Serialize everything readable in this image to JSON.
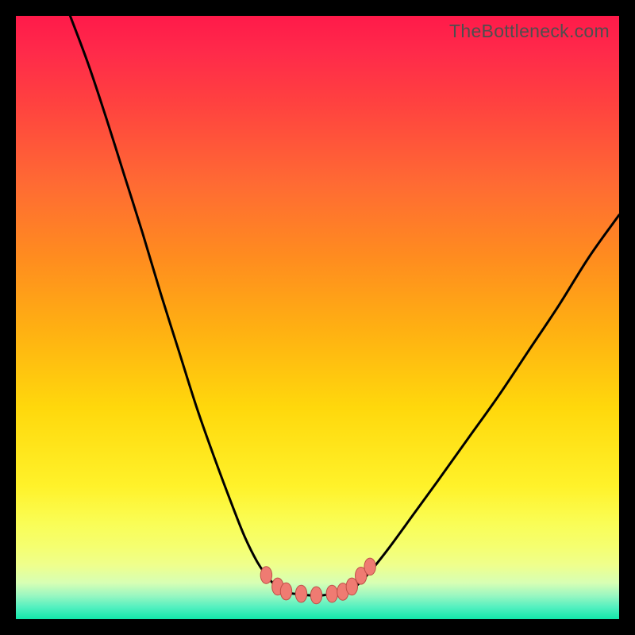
{
  "watermark": "TheBottleneck.com",
  "chart_data": {
    "type": "line",
    "title": "",
    "xlabel": "",
    "ylabel": "",
    "xlim": [
      0,
      100
    ],
    "ylim": [
      0,
      100
    ],
    "series": [
      {
        "name": "left-curve",
        "x": [
          9,
          12,
          15,
          18,
          21,
          24,
          27,
          30,
          33,
          36,
          38,
          40,
          41.5,
          43,
          44
        ],
        "values": [
          100,
          92,
          83,
          73.5,
          64,
          54,
          44.5,
          35,
          26.5,
          18.5,
          13.5,
          9.5,
          7.3,
          5.5,
          4.5
        ]
      },
      {
        "name": "right-curve",
        "x": [
          55,
          57,
          59,
          62,
          66,
          70,
          75,
          80,
          85,
          90,
          95,
          100
        ],
        "values": [
          4.5,
          6,
          8.2,
          12,
          17.5,
          23,
          30,
          37,
          44.5,
          52,
          60,
          67
        ]
      },
      {
        "name": "flat-bottom",
        "x": [
          44,
          47,
          50,
          52,
          55
        ],
        "values": [
          4.5,
          4.1,
          3.9,
          4.1,
          4.5
        ]
      }
    ],
    "annotations": [
      {
        "name": "bottom-markers",
        "type": "scatter",
        "x": [
          41.5,
          43.4,
          44.8,
          47.3,
          49.8,
          52.4,
          54.2,
          55.7,
          57.2,
          58.7
        ],
        "values": [
          7.3,
          5.4,
          4.6,
          4.2,
          3.95,
          4.2,
          4.55,
          5.4,
          7.2,
          8.7
        ]
      }
    ],
    "colors": {
      "curve": "#000000",
      "marker_fill": "#ef7b72",
      "marker_stroke": "#be4f47"
    }
  }
}
